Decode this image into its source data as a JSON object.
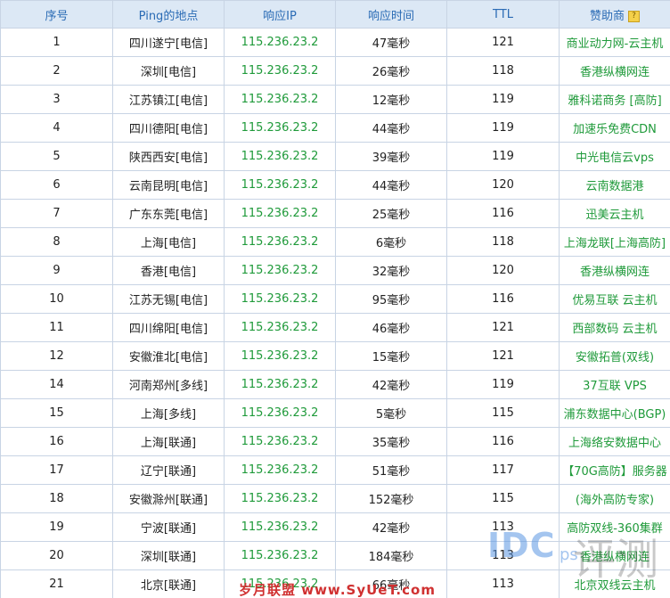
{
  "headers": {
    "index": "序号",
    "location": "Ping的地点",
    "ip": "响应IP",
    "time": "响应时间",
    "ttl": "TTL",
    "sponsor": "赞助商"
  },
  "rows": [
    {
      "index": "1",
      "location": "四川遂宁[电信]",
      "ip": "115.236.23.2",
      "time": "47毫秒",
      "ttl": "121",
      "sponsor": "商业动力网-云主机"
    },
    {
      "index": "2",
      "location": "深圳[电信]",
      "ip": "115.236.23.2",
      "time": "26毫秒",
      "ttl": "118",
      "sponsor": "香港纵横网连"
    },
    {
      "index": "3",
      "location": "江苏镇江[电信]",
      "ip": "115.236.23.2",
      "time": "12毫秒",
      "ttl": "119",
      "sponsor": "雅科诺商务 [高防]"
    },
    {
      "index": "4",
      "location": "四川德阳[电信]",
      "ip": "115.236.23.2",
      "time": "44毫秒",
      "ttl": "119",
      "sponsor": "加速乐免费CDN"
    },
    {
      "index": "5",
      "location": "陕西西安[电信]",
      "ip": "115.236.23.2",
      "time": "39毫秒",
      "ttl": "119",
      "sponsor": "中光电信云vps"
    },
    {
      "index": "6",
      "location": "云南昆明[电信]",
      "ip": "115.236.23.2",
      "time": "44毫秒",
      "ttl": "120",
      "sponsor": "云南数据港"
    },
    {
      "index": "7",
      "location": "广东东莞[电信]",
      "ip": "115.236.23.2",
      "time": "25毫秒",
      "ttl": "116",
      "sponsor": "迅美云主机"
    },
    {
      "index": "8",
      "location": "上海[电信]",
      "ip": "115.236.23.2",
      "time": "6毫秒",
      "ttl": "118",
      "sponsor": "上海龙联[上海高防]"
    },
    {
      "index": "9",
      "location": "香港[电信]",
      "ip": "115.236.23.2",
      "time": "32毫秒",
      "ttl": "120",
      "sponsor": "香港纵横网连"
    },
    {
      "index": "10",
      "location": "江苏无锡[电信]",
      "ip": "115.236.23.2",
      "time": "95毫秒",
      "ttl": "116",
      "sponsor": "优易互联 云主机"
    },
    {
      "index": "11",
      "location": "四川绵阳[电信]",
      "ip": "115.236.23.2",
      "time": "46毫秒",
      "ttl": "121",
      "sponsor": "西部数码 云主机"
    },
    {
      "index": "12",
      "location": "安徽淮北[电信]",
      "ip": "115.236.23.2",
      "time": "15毫秒",
      "ttl": "121",
      "sponsor": "安徽拓普(双线)"
    },
    {
      "index": "14",
      "location": "河南郑州[多线]",
      "ip": "115.236.23.2",
      "time": "42毫秒",
      "ttl": "119",
      "sponsor": "37互联 VPS"
    },
    {
      "index": "15",
      "location": "上海[多线]",
      "ip": "115.236.23.2",
      "time": "5毫秒",
      "ttl": "115",
      "sponsor": "浦东数据中心(BGP)"
    },
    {
      "index": "16",
      "location": "上海[联通]",
      "ip": "115.236.23.2",
      "time": "35毫秒",
      "ttl": "116",
      "sponsor": "上海络安数据中心"
    },
    {
      "index": "17",
      "location": "辽宁[联通]",
      "ip": "115.236.23.2",
      "time": "51毫秒",
      "ttl": "117",
      "sponsor": "【70G高防】服务器"
    },
    {
      "index": "18",
      "location": "安徽滁州[联通]",
      "ip": "115.236.23.2",
      "time": "152毫秒",
      "ttl": "115",
      "sponsor": "(海外高防专家)"
    },
    {
      "index": "19",
      "location": "宁波[联通]",
      "ip": "115.236.23.2",
      "time": "42毫秒",
      "ttl": "113",
      "sponsor": "高防双线-360集群"
    },
    {
      "index": "20",
      "location": "深圳[联通]",
      "ip": "115.236.23.2",
      "time": "184毫秒",
      "ttl": "113",
      "sponsor": "香港纵横网连"
    },
    {
      "index": "21",
      "location": "北京[联通]",
      "ip": "115.236.23.2",
      "time": "66毫秒",
      "ttl": "113",
      "sponsor": "北京双线云主机"
    }
  ],
  "watermark": {
    "idc": "IDC",
    "ps": "ps",
    "brush": "评测",
    "site": "岁月联盟 www.SyUeT.com"
  },
  "icons": {
    "sponsor_hint": "hint-icon"
  }
}
